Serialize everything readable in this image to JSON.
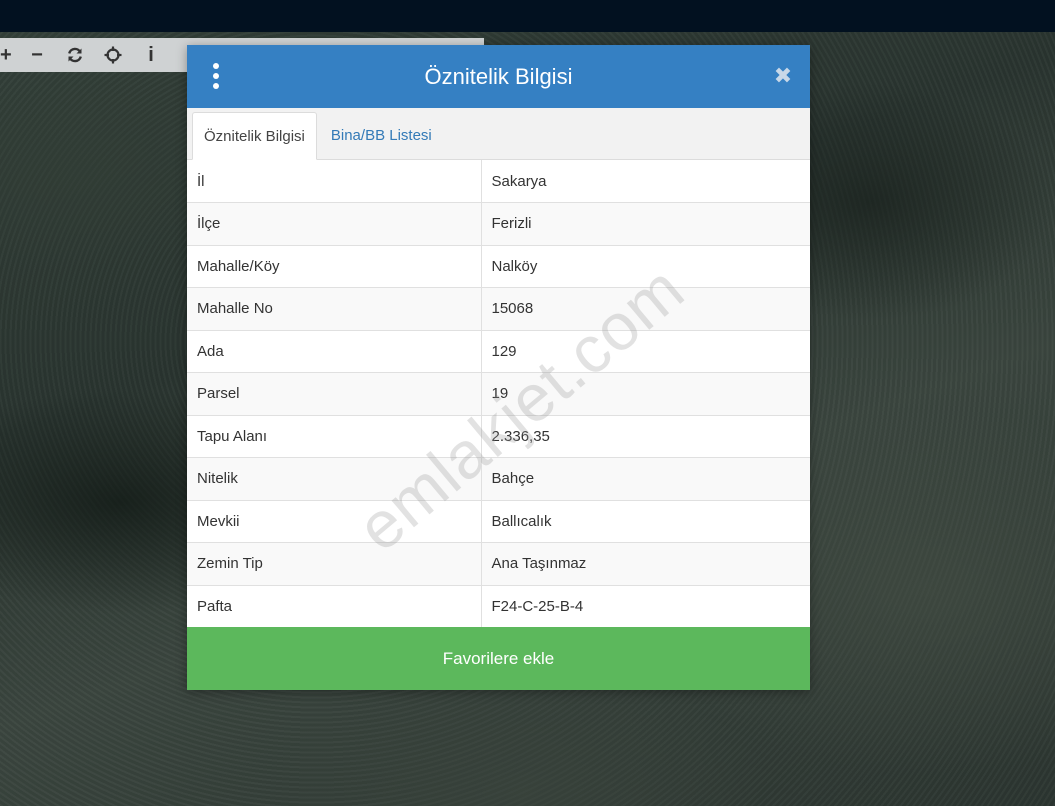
{
  "map": {
    "toolbar": [
      {
        "name": "zoom-in-icon",
        "glyph": "+"
      },
      {
        "name": "zoom-out-icon",
        "glyph": "−"
      },
      {
        "name": "refresh-icon",
        "glyph": ""
      },
      {
        "name": "locate-icon",
        "glyph": ""
      },
      {
        "name": "info-icon",
        "glyph": "i"
      }
    ]
  },
  "modal": {
    "title": "Öznitelik Bilgisi",
    "tabs": [
      {
        "label": "Öznitelik Bilgisi",
        "active": true
      },
      {
        "label": "Bina/BB Listesi",
        "active": false
      }
    ],
    "rows": [
      {
        "key": "İl",
        "value": "Sakarya"
      },
      {
        "key": "İlçe",
        "value": "Ferizli"
      },
      {
        "key": "Mahalle/Köy",
        "value": "Nalköy"
      },
      {
        "key": "Mahalle No",
        "value": "15068"
      },
      {
        "key": "Ada",
        "value": "129"
      },
      {
        "key": "Parsel",
        "value": "19"
      },
      {
        "key": "Tapu Alanı",
        "value": "2.336,35"
      },
      {
        "key": "Nitelik",
        "value": "Bahçe"
      },
      {
        "key": "Mevkii",
        "value": "Ballıcalık"
      },
      {
        "key": "Zemin Tip",
        "value": "Ana Taşınmaz"
      },
      {
        "key": "Pafta",
        "value": "F24-C-25-B-4"
      }
    ],
    "favorite_button": "Favorilere ekle",
    "close_glyph": "✖"
  },
  "watermark": "emlakjet.com",
  "colors": {
    "header": "#3580c3",
    "favorite_button": "#5cb85c",
    "tab_link": "#337ab7",
    "topbar": "#021120"
  }
}
